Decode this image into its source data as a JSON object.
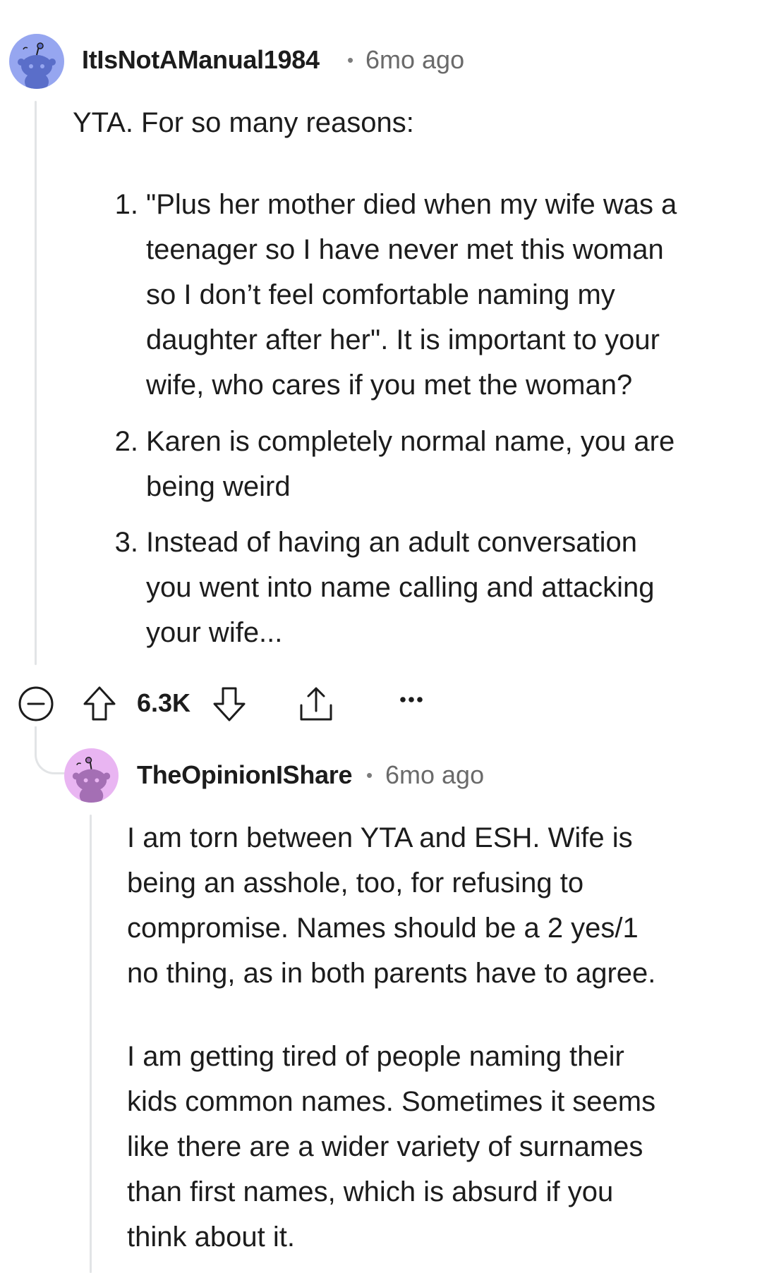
{
  "comments": [
    {
      "username": "ItIsNotAManual1984",
      "separator": "•",
      "timestamp": "6mo ago",
      "intro": "YTA. For so many reasons:",
      "list": [
        {
          "num": "1.",
          "lines": [
            "\"Plus her mother died when my wife was a",
            "teenager so I have never met this woman",
            "so I don’t feel comfortable naming my",
            "daughter after her\". It is important to your",
            "wife, who cares if you met the woman?"
          ]
        },
        {
          "num": "2.",
          "lines": [
            "Karen is completely normal name, you are",
            "being weird"
          ]
        },
        {
          "num": "3.",
          "lines": [
            "Instead of having an adult conversation",
            "you went into name calling and attacking",
            "your wife..."
          ]
        }
      ],
      "actions": {
        "score": "6.3K"
      }
    },
    {
      "username": "TheOpinionIShare",
      "separator": "•",
      "timestamp": "6mo ago",
      "paragraphs": [
        [
          "I am torn between YTA and ESH. Wife is",
          "being an asshole, too, for refusing to",
          "compromise. Names should be a 2 yes/1",
          "no thing, as in both parents have to agree."
        ],
        [
          "I am getting tired of people naming their",
          "kids common names. Sometimes it seems",
          "like there are a wider variety of surnames",
          "than first names, which is absurd if you",
          "think about it."
        ]
      ]
    }
  ],
  "icons": {
    "collapse": "minus-circle-icon",
    "upvote": "upvote-arrow-icon",
    "downvote": "downvote-arrow-icon",
    "share": "share-icon",
    "more": "more-options-icon"
  }
}
